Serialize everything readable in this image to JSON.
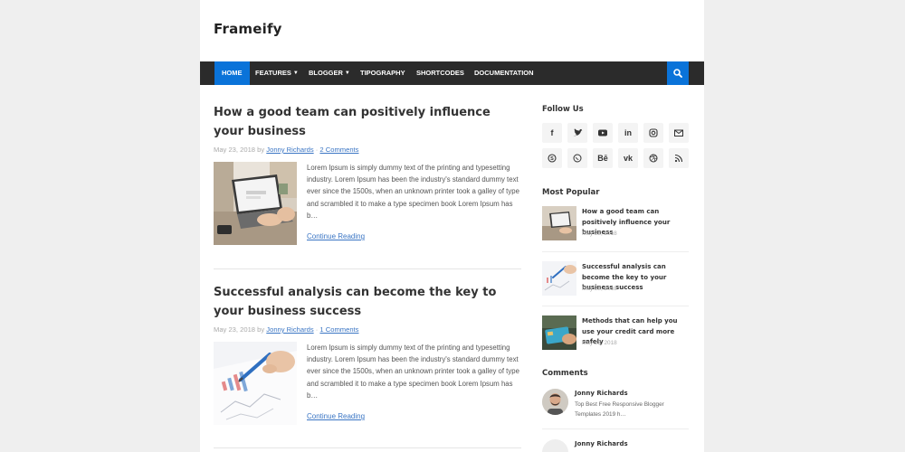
{
  "brand": "Frameify",
  "nav": {
    "home": "HOME",
    "features": "FEATURES",
    "blogger": "BLOGGER",
    "typography": "TIPOGRAPHY",
    "shortcodes": "SHORTCODES",
    "documentation": "DOCUMENTATION",
    "active_color": "#0a73d9",
    "search_icon": "search-icon"
  },
  "posts": [
    {
      "title": "How a good team can positively influence your business",
      "date": "May 23, 2018",
      "by": "by",
      "author": "Jonny Richards",
      "sep": "·",
      "comments": "2 Comments",
      "excerpt": "Lorem Ipsum is simply dummy text of the printing and typesetting industry. Lorem Ipsum has been the industry's standard dummy text ever since the 1500s, when an unknown printer took a galley of type and scrambled it to make a type specimen book Lorem Ipsum has b…",
      "continue": "Continue Reading"
    },
    {
      "title": "Successful analysis can become the key to your business success",
      "date": "May 23, 2018",
      "by": "by",
      "author": "Jonny Richards",
      "sep": "·",
      "comments": "1 Comments",
      "excerpt": "Lorem Ipsum is simply dummy text of the printing and typesetting industry. Lorem Ipsum has been the industry's standard dummy text ever since the 1500s, when an unknown printer took a galley of type and scrambled it to make a type specimen book Lorem Ipsum has b…",
      "continue": "Continue Reading"
    }
  ],
  "sidebar": {
    "follow_title": "Follow Us",
    "social": [
      {
        "name": "facebook-icon",
        "glyph": "f"
      },
      {
        "name": "twitter-icon",
        "glyph": ""
      },
      {
        "name": "youtube-icon",
        "glyph": ""
      },
      {
        "name": "linkedin-icon",
        "glyph": "in"
      },
      {
        "name": "instagram-icon",
        "glyph": ""
      },
      {
        "name": "email-icon",
        "glyph": ""
      },
      {
        "name": "skype-icon",
        "glyph": ""
      },
      {
        "name": "whatsapp-icon",
        "glyph": ""
      },
      {
        "name": "behance-icon",
        "glyph": "Bē"
      },
      {
        "name": "vk-icon",
        "glyph": "vk"
      },
      {
        "name": "dribbble-icon",
        "glyph": ""
      },
      {
        "name": "rss-icon",
        "glyph": ""
      }
    ],
    "popular_title": "Most Popular",
    "popular": [
      {
        "title": "How a good team can positively influence your business",
        "date": "May 23, 2018"
      },
      {
        "title": "Successful analysis can become the key to your business success",
        "date": "May 23, 2018"
      },
      {
        "title": "Methods that can help you use your credit card more safely",
        "date": "May 23, 2018"
      }
    ],
    "comments_title": "Comments",
    "comments": [
      {
        "author": "Jonny Richards",
        "text": "Top Best Free Responsive Blogger Templates 2019 h…"
      },
      {
        "author": "Jonny Richards",
        "text": ""
      }
    ]
  }
}
